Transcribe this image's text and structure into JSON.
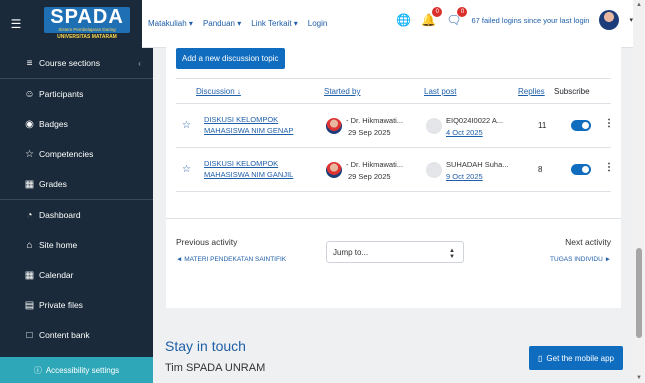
{
  "navbar": {
    "menu_icon": "hamburger-icon",
    "logo_title": "SPADA",
    "logo_sub": "Sistem Pembelajaran Daring",
    "logo_univ": "UNIVERSITAS MATARAM",
    "links": [
      "Matakuliah ▾",
      "Panduan ▾",
      "Link Terkait ▾",
      "Login"
    ],
    "notif_count": "0",
    "msg_count": "0",
    "failed_logins": "67 failed logins since your last login"
  },
  "sidebar": {
    "items": [
      {
        "label": "Course sections",
        "icon": "list-icon"
      },
      {
        "label": "Participants",
        "icon": "users-icon"
      },
      {
        "label": "Badges",
        "icon": "badge-icon"
      },
      {
        "label": "Competencies",
        "icon": "star-icon"
      },
      {
        "label": "Grades",
        "icon": "table-icon"
      },
      {
        "label": "Dashboard",
        "icon": "dashboard-icon"
      },
      {
        "label": "Site home",
        "icon": "home-icon"
      },
      {
        "label": "Calendar",
        "icon": "calendar-icon"
      },
      {
        "label": "Private files",
        "icon": "file-icon"
      },
      {
        "label": "Content bank",
        "icon": "content-bank-icon"
      }
    ],
    "accessibility": "Accessibility settings"
  },
  "forum": {
    "add_button": "Add a new discussion topic",
    "columns": {
      "discussion": "Discussion ↓",
      "started_by": "Started by",
      "last_post": "Last post",
      "replies": "Replies",
      "subscribe": "Subscribe"
    },
    "rows": [
      {
        "title": "DISKUSI KELOMPOK MAHASISWA NIM GENAP",
        "starter": "- Dr. Hikmawati...",
        "start_date": "29 Sep 2025",
        "last_by": "EIQ024I0022 A...",
        "last_date": "4 Oct 2025",
        "replies": "11",
        "subscribed": true
      },
      {
        "title": "DISKUSI KELOMPOK MAHASISWA NIM GANJIL",
        "starter": "- Dr. Hikmawati...",
        "start_date": "29 Sep 2025",
        "last_by": "SUHADAH Suha...",
        "last_date": "9 Oct 2025",
        "replies": "8",
        "subscribed": true
      }
    ]
  },
  "activity_nav": {
    "previous_label": "Previous activity",
    "previous_link": "◄ MATERI PENDEKATAN SAINTIFIK",
    "jump_placeholder": "Jump to...",
    "next_label": "Next activity",
    "next_link": "TUGAS INDIVIDU ►"
  },
  "footer": {
    "stay": "Stay in touch",
    "team": "Tim SPADA UNRAM",
    "mobile_button": "Get the mobile app"
  }
}
